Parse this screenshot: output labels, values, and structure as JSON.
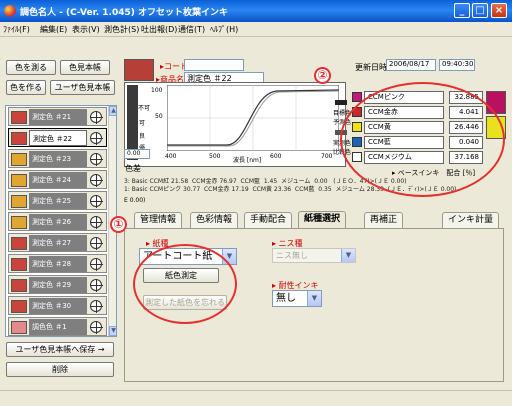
{
  "window": {
    "title": "調色名人 - (C-Ver. 1.045) オフセット枚葉インキ",
    "controls": [
      "_",
      "□",
      "×"
    ]
  },
  "menu": [
    "ﾌｧｲﾙ(F)",
    "編集(E)",
    "表示(V)",
    "測色計(S)",
    "吐出報(D)",
    "通信(T)",
    "ﾍﾙﾌﾟ(H)"
  ],
  "left": {
    "btn_measure": "色を測る",
    "btn_color_book": "色見本帳",
    "btn_make": "色を作る",
    "btn_user_book": "ユーザ色見本帳",
    "items": [
      {
        "label": "測定色 ＃21",
        "color": "#c9453c"
      },
      {
        "label": "測定色 ＃22",
        "color": "#c9453c",
        "selected": true
      },
      {
        "label": "測定色 ＃23",
        "color": "#e0a630"
      },
      {
        "label": "測定色 ＃24",
        "color": "#e0a630"
      },
      {
        "label": "測定色 ＃25",
        "color": "#e0a630"
      },
      {
        "label": "測定色 ＃26",
        "color": "#e0a630"
      },
      {
        "label": "測定色 ＃27",
        "color": "#c9453c"
      },
      {
        "label": "測定色 ＃28",
        "color": "#c9453c"
      },
      {
        "label": "測定色 ＃29",
        "color": "#c9453c"
      },
      {
        "label": "測定色 ＃30",
        "color": "#c9453c"
      },
      {
        "label": "調色色 ＃1",
        "color": "#e58a8a"
      }
    ],
    "btn_save": "ユーザ色見本帳へ保存 →",
    "btn_delete": "削除"
  },
  "header": {
    "code_label": "▸コード",
    "code_value": "",
    "name_label": "▸商品名",
    "name_value": "測定色 ＃22",
    "updated_label": "更新日時",
    "updated_date": "2006/08/17",
    "updated_time": "09:40:30"
  },
  "graph": {
    "scale_100": "100",
    "scale_50": "50",
    "value_0": "0.00",
    "x_400": "400",
    "x_500": "500",
    "x_600": "600",
    "x_700": "700",
    "x_unit": "波長 [nm]",
    "color_label": "色差",
    "side_labels": [
      "不可",
      "可",
      "良",
      "優"
    ],
    "right_labels": [
      "目標色",
      "予測色",
      "実測色",
      "比較色"
    ]
  },
  "inks": {
    "rows": [
      {
        "name": "CCMピンク",
        "value": "32.885",
        "color": "#c0197a"
      },
      {
        "name": "CCM金赤",
        "value": "4.041",
        "color": "#c6282b"
      },
      {
        "name": "CCM黄",
        "value": "26.446",
        "color": "#f0e600"
      },
      {
        "name": "CCM藍",
        "value": "0.040",
        "color": "#1b62b8"
      },
      {
        "name": "CCMメジウム",
        "value": "37.168",
        "color": "#ffffff"
      }
    ],
    "footer": "▸ ベースインキ　配合 [％]",
    "preview_colors": [
      "#b8115f",
      "#e8e21e"
    ]
  },
  "formula_text": "3: Basic CCM紅 21.58  CCM金赤 76.97  CCM藍  1.45  メジューム  0.00   (ＪＥＯ．47)>(ＪＥ 0.00)\n1: Basic CCMピンク 30.77  CCM金赤 17.19  CCM黄 23.36  CCM藍  0.35  メジューム 28.33  (ＪＥ．ﾃﾞｨ)>(ＪＥ 0.00)",
  "tabs": [
    "管理情報",
    "色彩情報",
    "手動配合",
    "紙種選択",
    "再補正",
    "インキ計量"
  ],
  "paper": {
    "paper_label": "▸ 紙種",
    "paper_value": "アートコート紙",
    "measure_btn": "紙色測定",
    "disabled_btn": "測定した紙色を忘れる",
    "varnish_label": "▸ ニス種",
    "varnish_value": "ニス無し",
    "resist_label": "▸ 耐性インキ",
    "resist_value": "無し"
  },
  "annotations": {
    "one": "①",
    "two": "②"
  }
}
